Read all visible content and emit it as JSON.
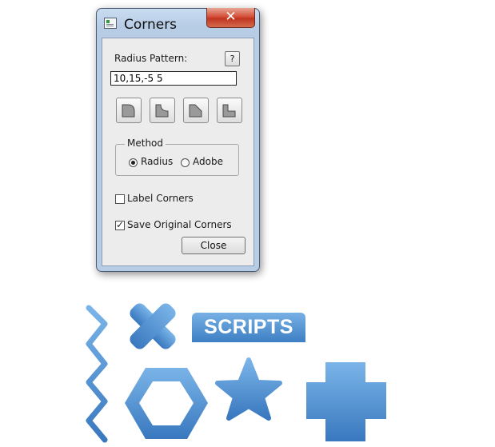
{
  "window": {
    "title": "Corners",
    "close_glyph": "✕",
    "titlebar_icon": "app-window-icon"
  },
  "form": {
    "radius_label": "Radius Pattern:",
    "help_label": "?",
    "radius_value": "10,15,-5 5",
    "corner_buttons": [
      {
        "icon": "round-corner-icon"
      },
      {
        "icon": "inverse-round-corner-icon"
      },
      {
        "icon": "chamfer-corner-icon"
      },
      {
        "icon": "notch-corner-icon"
      }
    ],
    "method": {
      "legend": "Method",
      "options": [
        {
          "label": "Radius",
          "selected": true
        },
        {
          "label": "Adobe",
          "selected": false
        }
      ]
    },
    "label_corners": {
      "label": "Label Corners",
      "checked": false,
      "check_glyph": ""
    },
    "save_original": {
      "label": "Save Original Corners",
      "checked": true,
      "check_glyph": "✓"
    },
    "close_label": "Close"
  },
  "logo": {
    "badge_text": "SCRIPTS",
    "colors": {
      "light": "#7ab4e8",
      "dark": "#3978bf"
    }
  }
}
